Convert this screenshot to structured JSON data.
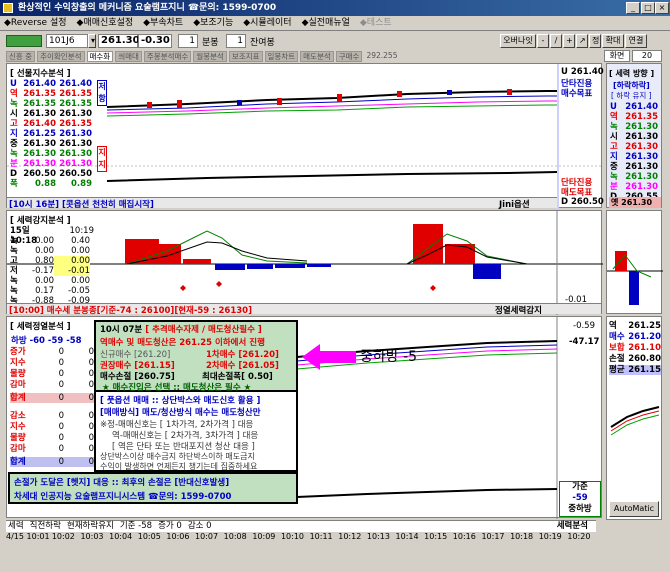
{
  "window": {
    "title": "환상적인 수익창출의 메커니즘 요술램프지니 ☎문의: 1599-0700"
  },
  "menu": [
    "Reverse 설정",
    "매매신호설정",
    "부속차트",
    "보조기능",
    "시뮬레이터",
    "실전매뉴얼",
    "테스트"
  ],
  "toolbar": {
    "code": "101J6",
    "price": "261.30",
    "change": "-0.30",
    "interval": "1",
    "interval_unit": "분봉",
    "count": "1",
    "count_unit": "잔여봉",
    "right_buttons": [
      "오버나잇",
      "-",
      "/",
      "+",
      "↗",
      "정",
      "확대",
      "연결"
    ],
    "screen_label": "화면",
    "screen_value": "20"
  },
  "tabs": [
    "신흥 중",
    "추이확인분석",
    "매수화",
    "씌매대",
    "주봉분석매수",
    "월봉분석",
    "보조지표",
    "일봉차트",
    "매도분석",
    "구매수"
  ],
  "tab_extra": "292.255",
  "panel1": {
    "title": "[ 선물지수분석 ]",
    "rows": [
      {
        "k": "U",
        "a": "261.40",
        "b": "261.40"
      },
      {
        "k": "역",
        "a": "261.35",
        "b": "261.35"
      },
      {
        "k": "녹",
        "a": "261.35",
        "b": "261.35"
      },
      {
        "k": "시",
        "a": "261.30",
        "b": "261.30"
      },
      {
        "k": "고",
        "a": "261.40",
        "b": "261.35"
      },
      {
        "k": "지",
        "a": "261.25",
        "b": "261.30"
      },
      {
        "k": "중",
        "a": "261.30",
        "b": "261.30"
      },
      {
        "k": "녹",
        "a": "261.30",
        "b": "261.30"
      },
      {
        "k": "분",
        "a": "261.30",
        "b": "261.30"
      },
      {
        "k": "D",
        "a": "260.50",
        "b": "260.50"
      },
      {
        "k": "폭",
        "a": "0.88",
        "b": "0.89"
      }
    ],
    "side_top": "저항",
    "side_bottom": "지지",
    "right_top": "U 261.40",
    "right_tag1": "단타진용",
    "right_tag2": "매수목표",
    "right_tag3": "단타진용",
    "right_tag4": "매도목표",
    "right_bottom": "D 260.50",
    "footer": "[10시 16분] [콧옵션 천천히 매집시작]",
    "footer_right": "Jini옵션"
  },
  "right_side": {
    "title": "[ 세력 방향 ]",
    "sub1": "[하락하락]",
    "sub2": "[ 하락 유지 ]",
    "labels": [
      "U",
      "역",
      "녹",
      "시",
      "고",
      "지",
      "중",
      "녹",
      "분",
      "D"
    ],
    "values": [
      "261.40",
      "261.35",
      "261.30",
      "261.30",
      "261.30",
      "261.30",
      "261.30",
      "261.30",
      "261.30",
      "260.55"
    ],
    "bottom": "옛 261.30"
  },
  "panel2": {
    "title": "[ 세력강지분석 ]",
    "rows": [
      {
        "k": "15일10:18",
        "a": "10:19"
      },
      {
        "k": "녹",
        "a": "0.00",
        "b": "0.40"
      },
      {
        "k": "녹",
        "a": "0.00",
        "b": "0.00"
      },
      {
        "k": "고",
        "a": "0.80",
        "b": "0.00"
      },
      {
        "k": "저",
        "a": "-0.17",
        "b": "-0.01"
      },
      {
        "k": "녹",
        "a": "0.00",
        "b": "0.00"
      },
      {
        "k": "녹",
        "a": "0.17",
        "b": "-0.05"
      },
      {
        "k": "녹",
        "a": "-0.88",
        "b": "-0.09"
      }
    ],
    "axis_right": "-0.01",
    "footer": "[10:00] 매수세 분봉종[기준-74 : 26100][현재-59 : 26130]",
    "footer_right": "정열세력감지"
  },
  "panel3": {
    "title": "[ 세력정열분석 ]",
    "header": "하방 -60  -59  -58",
    "rows_a": [
      {
        "k": "증가",
        "a": "0",
        "b": "0"
      },
      {
        "k": "지수",
        "a": "0",
        "b": "0"
      },
      {
        "k": "물량",
        "a": "0",
        "b": "0"
      },
      {
        "k": "감마",
        "a": "0",
        "b": "0"
      }
    ],
    "sum_a": {
      "k": "합계",
      "a": "0",
      "b": "0"
    },
    "rows_b": [
      {
        "k": "감소",
        "a": "0",
        "b": "0"
      },
      {
        "k": "지수",
        "a": "0",
        "b": "0"
      },
      {
        "k": "물량",
        "a": "0",
        "b": "0"
      },
      {
        "k": "감마",
        "a": "0",
        "b": "0"
      }
    ],
    "sum_b": {
      "k": "합계",
      "a": "0",
      "b": "0"
    },
    "axis_top": "-0.59",
    "axis_2": "-47.17",
    "right_label1": "가준",
    "right_label2": "-59",
    "right_label3": "중하방"
  },
  "popup": {
    "title_time": "10시 07분",
    "title_rest": "[ 추격매수자제 / 매도청산필수 ]",
    "l1": "역매수 및 매도청산은 261.25 이하에서 진행",
    "l2a": "신규매수 [261.20]",
    "l2b": "1차매수 [261.20]",
    "l3a": "권장매수 [261.15]",
    "l3b": "2차매수 [261.05]",
    "l4a": "매수손절 [260.75]",
    "l4b": "최대손절폭[ 0.50]",
    "l5": "★ 매수진입은 선택  ::  매도청산은 필수 ★",
    "s1": "[ 풋옵션 매매 :: 상단박스와 매도신호 활용 ]",
    "s2": "[매매방식] 매도/청산방식 매수는 매도청산만",
    "s3": "※정-매매신호는 [ 1차가격, 2차가격 ] 대응",
    "s4": "역-매매신호는 [ 2차가격, 3차가격 ] 대응",
    "s5": "[ 역은 단타 또는 반대포지션 청산 대응 ]",
    "s6": "상단박스이상 매수금지  하단박스이하 매도금지",
    "s7": "수익이 발생하면 언제든지 챙기는데 집중하세요",
    "b1": "손절가 도달은 [헷지] 대응 :: 최후의 손절은 [반대신호발생]",
    "b2": "차세대 인공지능 요술램프지니시스템 ☎문의: 1599-0700"
  },
  "callout": "중하방 -5",
  "right3": {
    "rows": [
      {
        "k": "역",
        "v": "261.25"
      },
      {
        "k": "매수",
        "v": "261.20"
      },
      {
        "k": "보합",
        "v": "261.10"
      },
      {
        "k": "손절",
        "v": "260.80"
      },
      {
        "k": "평균",
        "v": "261.15"
      }
    ]
  },
  "status": {
    "items": [
      "세력",
      "직전하락",
      "현재하락유지",
      "기준 -58",
      "증가 0",
      "감소 0"
    ],
    "right": "세력분석"
  },
  "xaxis": [
    "4/15 10:01",
    "10:02",
    "10:03",
    "10:04",
    "10:05",
    "10:06",
    "10:07",
    "10:08",
    "10:09",
    "10:10",
    "10:11",
    "10:12",
    "10:13",
    "10:14",
    "10:15",
    "10:16",
    "10:17",
    "10:18",
    "10:19",
    "10:20"
  ],
  "automatic": "AutoMatic",
  "colors": {
    "red": "#e00000",
    "blue": "#0000c0",
    "green": "#008000",
    "magenta": "#ff00ff"
  }
}
